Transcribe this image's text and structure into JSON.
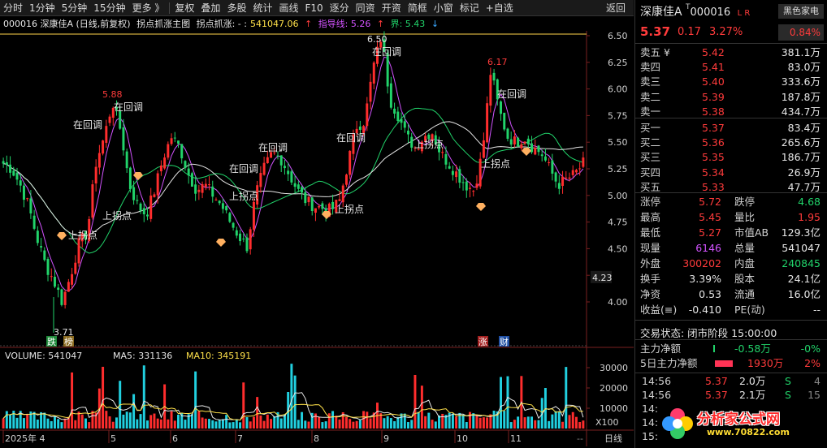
{
  "toolbar": {
    "items": [
      "分时",
      "1分钟",
      "5分钟",
      "15分钟",
      "更多 》",
      "复权",
      "叠加",
      "多股",
      "统计",
      "画线",
      "F10",
      "逐分",
      "同资",
      "开资",
      "简框",
      "小窗",
      "标记",
      "+自选",
      "返回"
    ]
  },
  "infoline": {
    "code_name": "000016 深康佳A (日线,前复权)",
    "indicator": "拐点抓涨主图",
    "indicator_value_label": "拐点抓涨: - :",
    "indicator_value": "541047.06",
    "guide_label": "指导线: 5.26",
    "bound_label": "界: 5.43"
  },
  "price_axis": [
    "6.50",
    "6.25",
    "6.00",
    "5.75",
    "5.50",
    "5.25",
    "5.00",
    "4.75",
    "4.50",
    "4.25",
    "4.00"
  ],
  "current_price_tag": "4.23",
  "annotations": {
    "high_label": "6.50",
    "peak1": "5.88",
    "peak2": "6.17",
    "low_label": "3.71",
    "retrace": "在回调",
    "turn_up": "上拐点",
    "tag_drop": "跌",
    "tag_list": "榜",
    "tag_rise": "涨",
    "tag_fin": "财"
  },
  "volume": {
    "label": "VOLUME: 541047",
    "ma5_label": "MA5: 331136",
    "ma10_label": "MA10: 345191",
    "axis": [
      "30000",
      "20000",
      "10000"
    ],
    "unit": "X100"
  },
  "date_axis": {
    "labels": [
      "2025年 4",
      "5",
      "6",
      "7",
      "8",
      "9",
      "10",
      "11"
    ],
    "period": "日线",
    "extra": "--"
  },
  "panel": {
    "name": "深康佳A",
    "code": "000016",
    "lr": "L R",
    "sector": "黑色家电",
    "price": "5.37",
    "change": "0.17",
    "change_pct": "3.27%",
    "turnover_tag": "0.84%",
    "orderbook": [
      {
        "label": "卖五 ¥",
        "price": "5.42",
        "vol": "381.1万"
      },
      {
        "label": "卖四",
        "price": "5.41",
        "vol": "83.0万"
      },
      {
        "label": "卖三",
        "price": "5.40",
        "vol": "333.6万"
      },
      {
        "label": "卖二",
        "price": "5.39",
        "vol": "187.8万"
      },
      {
        "label": "卖一",
        "price": "5.38",
        "vol": "434.7万"
      },
      {
        "label": "买一",
        "price": "5.37",
        "vol": "83.4万"
      },
      {
        "label": "买二",
        "price": "5.36",
        "vol": "265.6万"
      },
      {
        "label": "买三",
        "price": "5.35",
        "vol": "186.7万"
      },
      {
        "label": "买四",
        "price": "5.34",
        "vol": "26.9万"
      },
      {
        "label": "买五",
        "price": "5.33",
        "vol": "47.7万"
      }
    ],
    "stats": [
      {
        "l1": "涨停",
        "v1": "5.72",
        "c1": "red",
        "l2": "跌停",
        "v2": "4.68",
        "c2": "green"
      },
      {
        "l1": "最高",
        "v1": "5.45",
        "c1": "red",
        "l2": "量比",
        "v2": "1.95",
        "c2": "red"
      },
      {
        "l1": "最低",
        "v1": "5.27",
        "c1": "red",
        "l2": "市值AB",
        "v2": "129.3亿",
        "c2": "white"
      },
      {
        "l1": "现量",
        "v1": "6146",
        "c1": "purple",
        "l2": "总量",
        "v2": "541047",
        "c2": "white"
      },
      {
        "l1": "外盘",
        "v1": "300202",
        "c1": "red",
        "l2": "内盘",
        "v2": "240845",
        "c2": "green"
      },
      {
        "l1": "换手",
        "v1": "3.39%",
        "c1": "white",
        "l2": "股本",
        "v2": "24.1亿",
        "c2": "white"
      },
      {
        "l1": "净资",
        "v1": "0.53",
        "c1": "white",
        "l2": "流通",
        "v2": "16.0亿",
        "c2": "white"
      },
      {
        "l1": "收益(≡)",
        "v1": "-0.410",
        "c1": "white",
        "l2": "PE(动)",
        "v2": "--",
        "c2": "white"
      }
    ],
    "trade_state": "交易状态: 闭市阶段 15:00:00",
    "main_flow_label": "主力净额",
    "main_flow_value": "-0.58万",
    "main_flow_pct": "-0%",
    "flow5_label": "5日主力净额",
    "flow5_value": "1930万",
    "flow5_pct": "2%",
    "ticks": [
      {
        "time": "14:56",
        "price": "5.37",
        "vol": "2.0万",
        "side": "S",
        "n": "4"
      },
      {
        "time": "14:56",
        "price": "5.37",
        "vol": "2.1万",
        "side": "S",
        "n": "15"
      },
      {
        "time": "14:",
        "price": "",
        "vol": "",
        "side": "",
        "n": ""
      },
      {
        "time": "14:",
        "price": "",
        "vol": "",
        "side": "",
        "n": ""
      },
      {
        "time": "15:",
        "price": "",
        "vol": "",
        "side": "",
        "n": ""
      }
    ]
  },
  "watermark": {
    "line1": "分析家公式网",
    "line2": "www.70822.com"
  }
}
